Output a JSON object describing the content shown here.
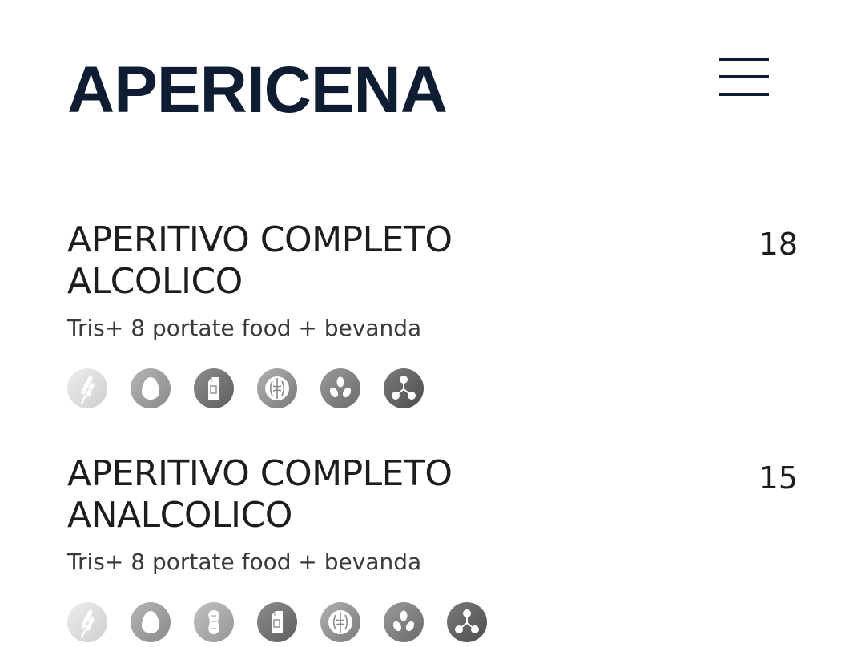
{
  "header": {
    "title": "APERICENA",
    "menu_icon": "hamburger-menu-icon"
  },
  "items": [
    {
      "name": "APERITIVO COMPLETO ALCOLICO",
      "price": "18",
      "description": "Tris+ 8 portate food + bevanda",
      "allergens": [
        "gluten-icon",
        "egg-icon",
        "milk-icon",
        "nuts-icon",
        "soy-icon",
        "sulfites-icon"
      ]
    },
    {
      "name": "APERITIVO COMPLETO ANALCOLICO",
      "price": "15",
      "description": "Tris+ 8 portate food + bevanda",
      "allergens": [
        "gluten-icon",
        "egg-icon",
        "peanut-icon",
        "milk-icon",
        "nuts-icon",
        "soy-icon",
        "sulfites-icon"
      ]
    }
  ],
  "colors": {
    "title": "#0f1d33",
    "text": "#1d1d1d",
    "icon_light": "#dcdcdc",
    "icon_mid": "#9a9a9a",
    "icon_dark": "#6a6a6a"
  }
}
